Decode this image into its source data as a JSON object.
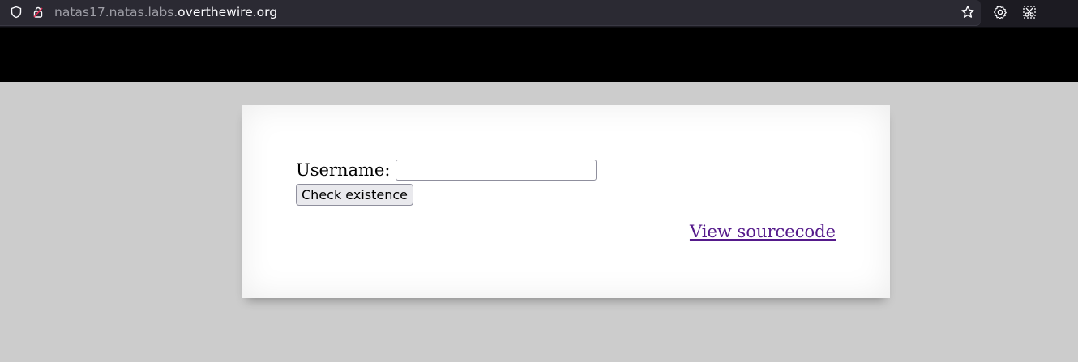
{
  "browser": {
    "url_subdomain": "natas17.natas.labs.",
    "url_domain": "overthewire.org",
    "icons": {
      "tracking": "shield-icon",
      "security": "lock-icon",
      "bookmark": "star-icon",
      "settings": "gear-icon",
      "screenshot": "screenshot-icon"
    }
  },
  "form": {
    "username_label": "Username:",
    "username_value": "",
    "submit_label": "Check existence"
  },
  "links": {
    "view_source": "View sourcecode"
  },
  "colors": {
    "page_background": "#cccccc",
    "header_background": "#000000",
    "panel_background": "#ffffff",
    "visited_link": "#551a8b"
  }
}
